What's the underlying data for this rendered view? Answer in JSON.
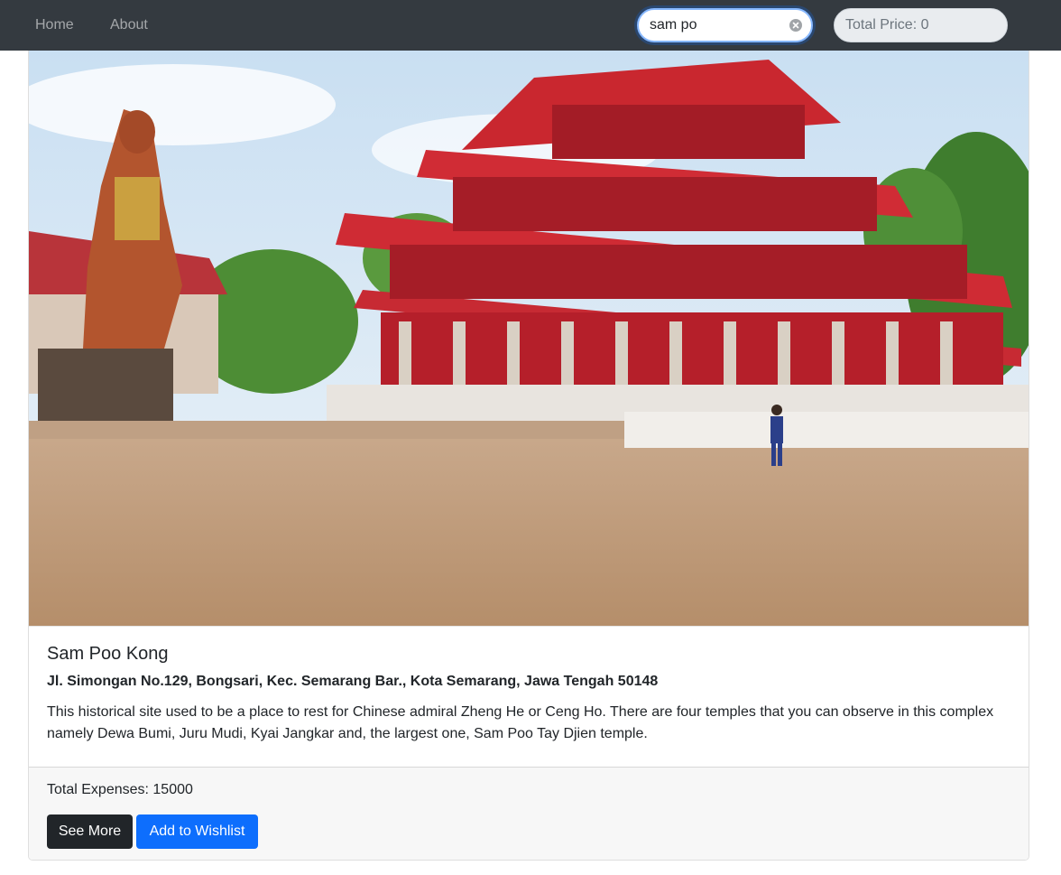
{
  "nav": {
    "home_label": "Home",
    "about_label": "About"
  },
  "search": {
    "value": "sam po",
    "clear_icon": "clear-icon"
  },
  "total_price": {
    "label": "Total Price: 0"
  },
  "card": {
    "image_icon": "temple-photo",
    "title": "Sam Poo Kong",
    "address": "Jl. Simongan No.129, Bongsari, Kec. Semarang Bar., Kota Semarang, Jawa Tengah 50148",
    "description": "This historical site used to be a place to rest for Chinese admiral Zheng He or Ceng Ho. There are four temples that you can observe in this complex namely Dewa Bumi, Juru Mudi, Kyai Jangkar and, the largest one, Sam Poo Tay Djien temple.",
    "expenses": "Total Expenses: 15000",
    "see_more_label": "See More",
    "wishlist_label": "Add to Wishlist"
  },
  "colors": {
    "navbar": "#343a40",
    "primary": "#0d6efd",
    "dark_button": "#212529",
    "footer_bg": "#f7f7f7"
  }
}
